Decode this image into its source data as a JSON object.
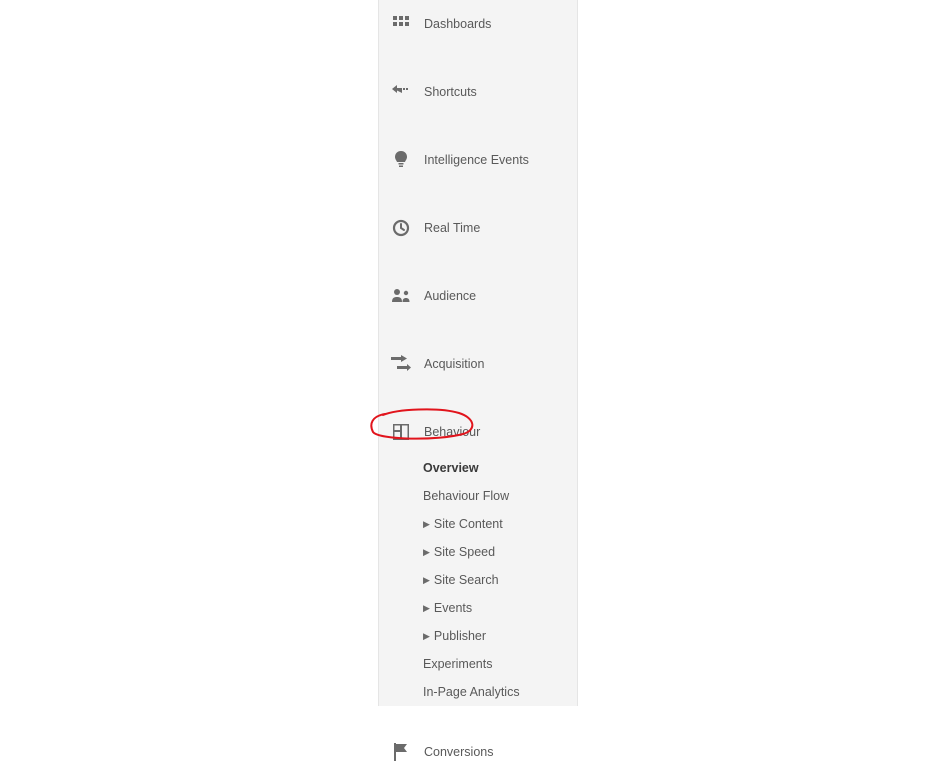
{
  "sidebar": {
    "items": [
      {
        "label": "Dashboards",
        "icon": "grid-icon"
      },
      {
        "label": "Shortcuts",
        "icon": "shortcuts-icon"
      },
      {
        "label": "Intelligence Events",
        "icon": "bulb-icon"
      },
      {
        "label": "Real Time",
        "icon": "clock-icon"
      },
      {
        "label": "Audience",
        "icon": "audience-icon"
      },
      {
        "label": "Acquisition",
        "icon": "acquisition-icon"
      },
      {
        "label": "Behaviour",
        "icon": "behaviour-icon",
        "expanded": true
      },
      {
        "label": "Conversions",
        "icon": "flag-icon"
      }
    ],
    "behaviour_sub": [
      {
        "label": "Overview",
        "selected": true,
        "caret": false
      },
      {
        "label": "Behaviour Flow",
        "selected": false,
        "caret": false
      },
      {
        "label": "Site Content",
        "selected": false,
        "caret": true
      },
      {
        "label": "Site Speed",
        "selected": false,
        "caret": true
      },
      {
        "label": "Site Search",
        "selected": false,
        "caret": true
      },
      {
        "label": "Events",
        "selected": false,
        "caret": true
      },
      {
        "label": "Publisher",
        "selected": false,
        "caret": true
      },
      {
        "label": "Experiments",
        "selected": false,
        "caret": false
      },
      {
        "label": "In-Page Analytics",
        "selected": false,
        "caret": false
      }
    ]
  },
  "annotation": {
    "circled_item": "Behaviour"
  }
}
